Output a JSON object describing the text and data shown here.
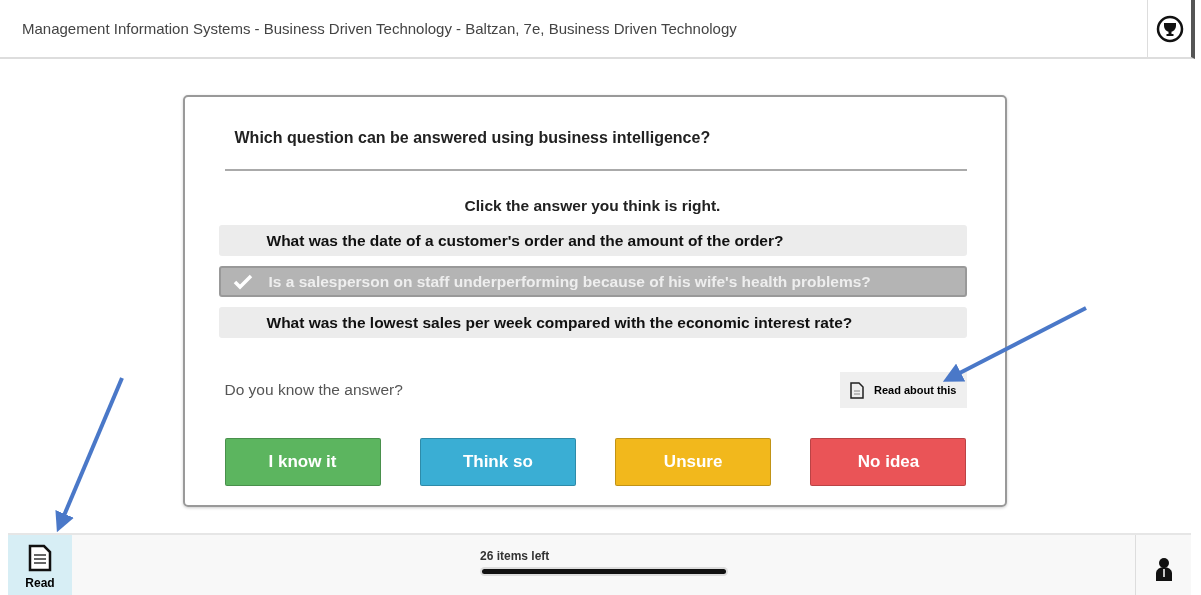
{
  "header": {
    "title": "Management Information Systems - Business Driven Technology - Baltzan, 7e, Business Driven Technology"
  },
  "question": {
    "text": "Which question can be answered using business intelligence?",
    "instruction": "Click the answer you think is right.",
    "answers": [
      {
        "text": "What was the date of a customer's order and the amount of the order?",
        "selected": false
      },
      {
        "text": "Is a salesperson on staff underperforming because of his wife's health problems?",
        "selected": true
      },
      {
        "text": "What was the lowest sales per week compared with the economic interest rate?",
        "selected": false
      }
    ],
    "confidence_prompt": "Do you know the answer?",
    "read_about": "Read about this",
    "confidence_buttons": [
      {
        "label": "I know it",
        "color": "#5cb55f"
      },
      {
        "label": "Think so",
        "color": "#3aaed4"
      },
      {
        "label": "Unsure",
        "color": "#f2b81c"
      },
      {
        "label": "No idea",
        "color": "#ea5457"
      }
    ]
  },
  "footer": {
    "read_label": "Read",
    "items_left": "26 items left",
    "progress": {
      "level": 1
    }
  }
}
